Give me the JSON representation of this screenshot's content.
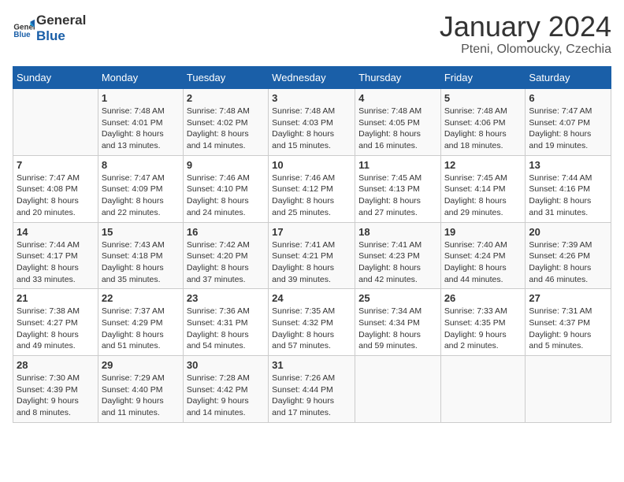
{
  "header": {
    "logo_line1": "General",
    "logo_line2": "Blue",
    "month": "January 2024",
    "location": "Pteni, Olomoucky, Czechia"
  },
  "weekdays": [
    "Sunday",
    "Monday",
    "Tuesday",
    "Wednesday",
    "Thursday",
    "Friday",
    "Saturday"
  ],
  "weeks": [
    [
      {
        "day": "",
        "info": ""
      },
      {
        "day": "1",
        "info": "Sunrise: 7:48 AM\nSunset: 4:01 PM\nDaylight: 8 hours\nand 13 minutes."
      },
      {
        "day": "2",
        "info": "Sunrise: 7:48 AM\nSunset: 4:02 PM\nDaylight: 8 hours\nand 14 minutes."
      },
      {
        "day": "3",
        "info": "Sunrise: 7:48 AM\nSunset: 4:03 PM\nDaylight: 8 hours\nand 15 minutes."
      },
      {
        "day": "4",
        "info": "Sunrise: 7:48 AM\nSunset: 4:05 PM\nDaylight: 8 hours\nand 16 minutes."
      },
      {
        "day": "5",
        "info": "Sunrise: 7:48 AM\nSunset: 4:06 PM\nDaylight: 8 hours\nand 18 minutes."
      },
      {
        "day": "6",
        "info": "Sunrise: 7:47 AM\nSunset: 4:07 PM\nDaylight: 8 hours\nand 19 minutes."
      }
    ],
    [
      {
        "day": "7",
        "info": "Sunrise: 7:47 AM\nSunset: 4:08 PM\nDaylight: 8 hours\nand 20 minutes."
      },
      {
        "day": "8",
        "info": "Sunrise: 7:47 AM\nSunset: 4:09 PM\nDaylight: 8 hours\nand 22 minutes."
      },
      {
        "day": "9",
        "info": "Sunrise: 7:46 AM\nSunset: 4:10 PM\nDaylight: 8 hours\nand 24 minutes."
      },
      {
        "day": "10",
        "info": "Sunrise: 7:46 AM\nSunset: 4:12 PM\nDaylight: 8 hours\nand 25 minutes."
      },
      {
        "day": "11",
        "info": "Sunrise: 7:45 AM\nSunset: 4:13 PM\nDaylight: 8 hours\nand 27 minutes."
      },
      {
        "day": "12",
        "info": "Sunrise: 7:45 AM\nSunset: 4:14 PM\nDaylight: 8 hours\nand 29 minutes."
      },
      {
        "day": "13",
        "info": "Sunrise: 7:44 AM\nSunset: 4:16 PM\nDaylight: 8 hours\nand 31 minutes."
      }
    ],
    [
      {
        "day": "14",
        "info": "Sunrise: 7:44 AM\nSunset: 4:17 PM\nDaylight: 8 hours\nand 33 minutes."
      },
      {
        "day": "15",
        "info": "Sunrise: 7:43 AM\nSunset: 4:18 PM\nDaylight: 8 hours\nand 35 minutes."
      },
      {
        "day": "16",
        "info": "Sunrise: 7:42 AM\nSunset: 4:20 PM\nDaylight: 8 hours\nand 37 minutes."
      },
      {
        "day": "17",
        "info": "Sunrise: 7:41 AM\nSunset: 4:21 PM\nDaylight: 8 hours\nand 39 minutes."
      },
      {
        "day": "18",
        "info": "Sunrise: 7:41 AM\nSunset: 4:23 PM\nDaylight: 8 hours\nand 42 minutes."
      },
      {
        "day": "19",
        "info": "Sunrise: 7:40 AM\nSunset: 4:24 PM\nDaylight: 8 hours\nand 44 minutes."
      },
      {
        "day": "20",
        "info": "Sunrise: 7:39 AM\nSunset: 4:26 PM\nDaylight: 8 hours\nand 46 minutes."
      }
    ],
    [
      {
        "day": "21",
        "info": "Sunrise: 7:38 AM\nSunset: 4:27 PM\nDaylight: 8 hours\nand 49 minutes."
      },
      {
        "day": "22",
        "info": "Sunrise: 7:37 AM\nSunset: 4:29 PM\nDaylight: 8 hours\nand 51 minutes."
      },
      {
        "day": "23",
        "info": "Sunrise: 7:36 AM\nSunset: 4:31 PM\nDaylight: 8 hours\nand 54 minutes."
      },
      {
        "day": "24",
        "info": "Sunrise: 7:35 AM\nSunset: 4:32 PM\nDaylight: 8 hours\nand 57 minutes."
      },
      {
        "day": "25",
        "info": "Sunrise: 7:34 AM\nSunset: 4:34 PM\nDaylight: 8 hours\nand 59 minutes."
      },
      {
        "day": "26",
        "info": "Sunrise: 7:33 AM\nSunset: 4:35 PM\nDaylight: 9 hours\nand 2 minutes."
      },
      {
        "day": "27",
        "info": "Sunrise: 7:31 AM\nSunset: 4:37 PM\nDaylight: 9 hours\nand 5 minutes."
      }
    ],
    [
      {
        "day": "28",
        "info": "Sunrise: 7:30 AM\nSunset: 4:39 PM\nDaylight: 9 hours\nand 8 minutes."
      },
      {
        "day": "29",
        "info": "Sunrise: 7:29 AM\nSunset: 4:40 PM\nDaylight: 9 hours\nand 11 minutes."
      },
      {
        "day": "30",
        "info": "Sunrise: 7:28 AM\nSunset: 4:42 PM\nDaylight: 9 hours\nand 14 minutes."
      },
      {
        "day": "31",
        "info": "Sunrise: 7:26 AM\nSunset: 4:44 PM\nDaylight: 9 hours\nand 17 minutes."
      },
      {
        "day": "",
        "info": ""
      },
      {
        "day": "",
        "info": ""
      },
      {
        "day": "",
        "info": ""
      }
    ]
  ]
}
